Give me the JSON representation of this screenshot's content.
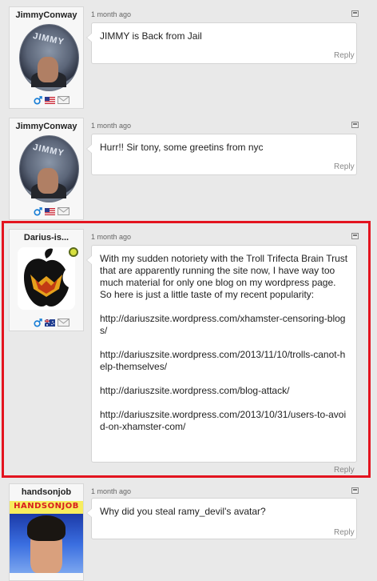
{
  "comments": [
    {
      "username": "JimmyConway",
      "avatar_label": "JIMMY",
      "timestamp": "1 month ago",
      "text": "JIMMY is Back from Jail",
      "reply_label": "Reply",
      "flag": "us-flag"
    },
    {
      "username": "JimmyConway",
      "avatar_label": "JIMMY",
      "timestamp": "1 month ago",
      "text": "Hurr!! Sir tony, some greetins from nyc",
      "reply_label": "Reply",
      "flag": "us-flag"
    },
    {
      "username": "Darius-is...",
      "timestamp": "1 month ago",
      "paragraphs": [
        "With my sudden notoriety with the Troll Trifecta Brain Trust that are apparently running the site now, I have way too much material for only one blog on my wordpress page. So here is just a little taste of my recent popularity:",
        "http://dariuszsite.wordpress.com/xhamster-censoring-blogs/",
        "http://dariuszsite.wordpress.com/2013/11/10/trolls-canot-help-themselves/",
        "http://dariuszsite.wordpress.com/blog-attack/",
        "http://dariuszsite.wordpress.com/2013/10/31/users-to-avoid-on-xhamster-com/"
      ],
      "reply_label": "Reply",
      "flag": "au-flag"
    },
    {
      "username": "handsonjob",
      "avatar_label": "HANDSONJOB",
      "timestamp": "1 month ago",
      "text": "Why did you steal ramy_devil's avatar?",
      "reply_label": "Reply"
    }
  ],
  "colors": {
    "highlight": "#e3141f",
    "gender_blue": "#1a7fd6",
    "background": "#e9e9e9"
  }
}
